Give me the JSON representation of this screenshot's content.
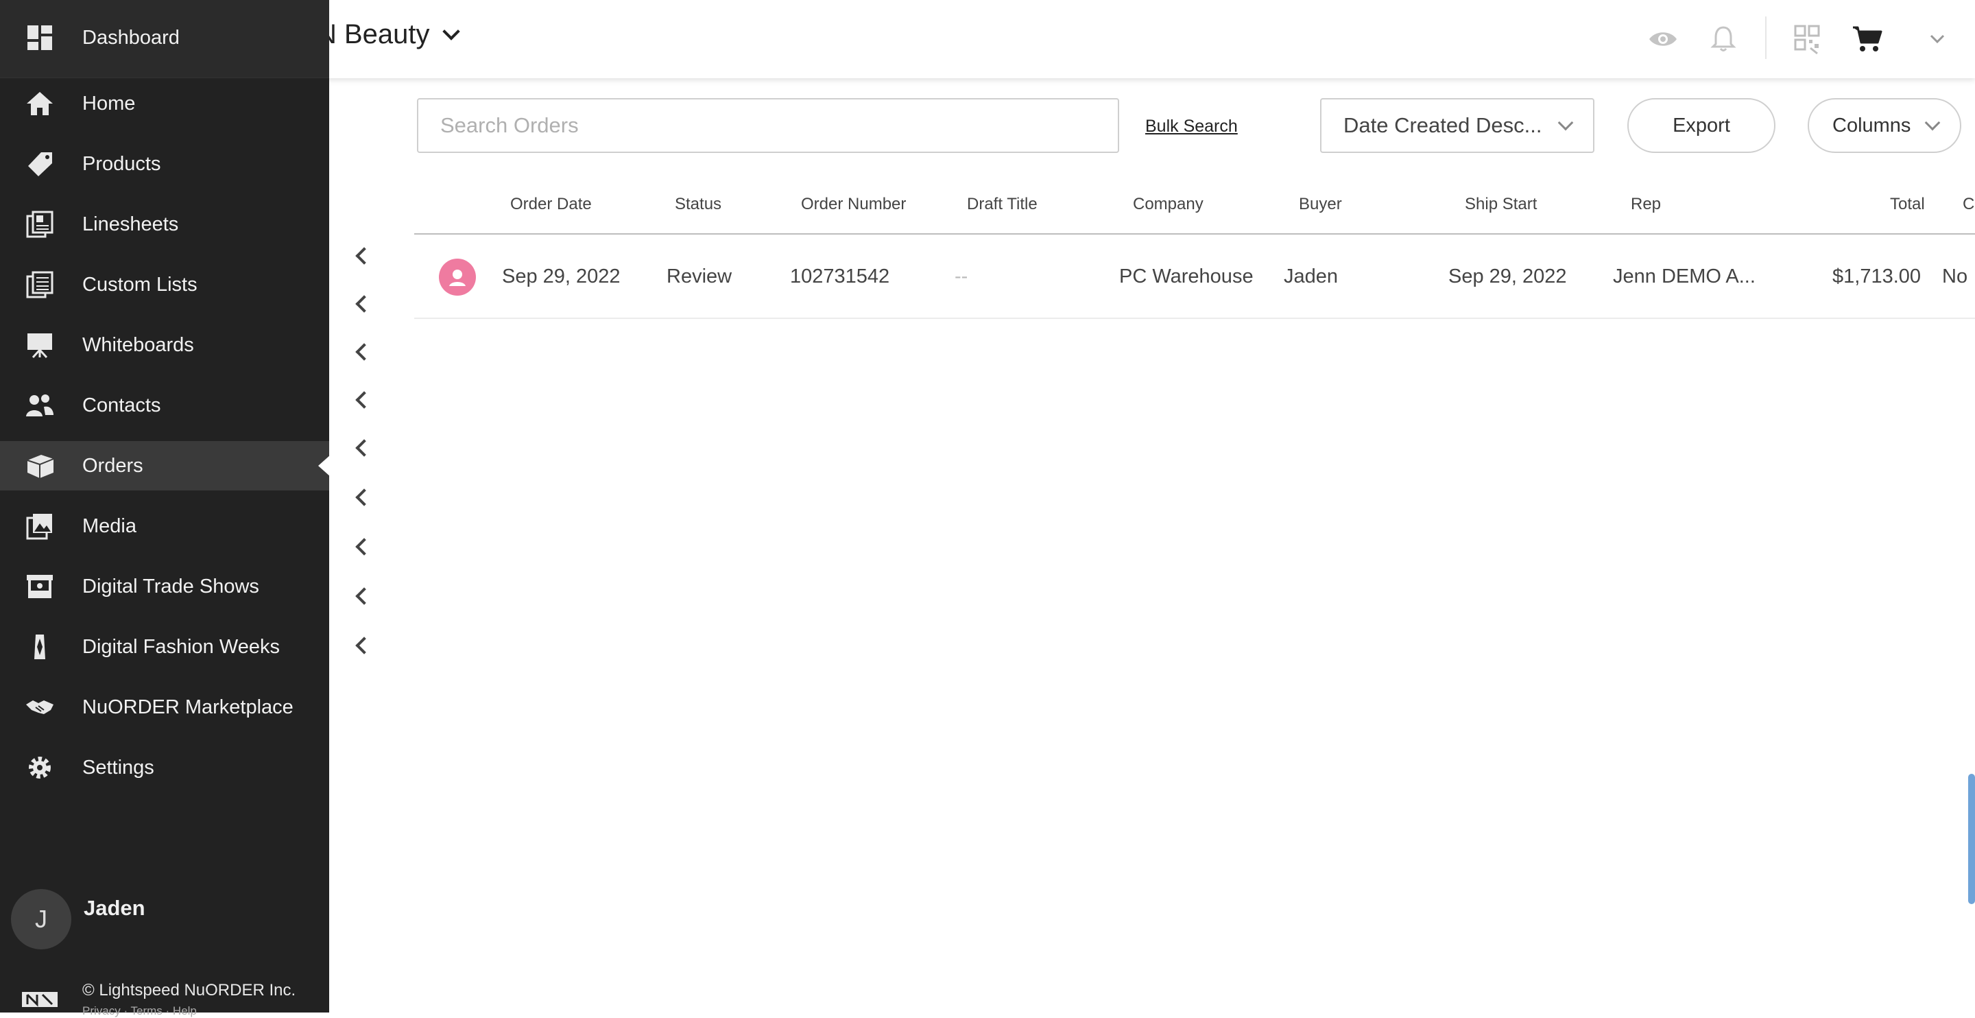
{
  "header": {
    "brand_name": "N Beauty",
    "icons": [
      "eye-icon",
      "bell-icon",
      "qr-code-icon",
      "cart-icon",
      "chevron-down-icon"
    ]
  },
  "sidebar": {
    "items": [
      {
        "label": "Dashboard",
        "icon": "dashboard-icon"
      },
      {
        "label": "Home",
        "icon": "home-icon"
      },
      {
        "label": "Products",
        "icon": "tag-icon"
      },
      {
        "label": "Linesheets",
        "icon": "linesheet-icon"
      },
      {
        "label": "Custom Lists",
        "icon": "list-icon"
      },
      {
        "label": "Whiteboards",
        "icon": "easel-icon"
      },
      {
        "label": "Contacts",
        "icon": "contacts-icon"
      },
      {
        "label": "Orders",
        "icon": "box-icon",
        "active": true
      },
      {
        "label": "Media",
        "icon": "media-icon"
      },
      {
        "label": "Digital Trade Shows",
        "icon": "booth-icon"
      },
      {
        "label": "Digital Fashion Weeks",
        "icon": "dress-icon"
      },
      {
        "label": "NuORDER Marketplace",
        "icon": "handshake-icon"
      },
      {
        "label": "Settings",
        "icon": "gear-icon"
      }
    ],
    "user": {
      "initial": "J",
      "name": "Jaden"
    },
    "copyright": "© Lightspeed NuORDER Inc.",
    "legal": "Privacy · Terms · Help"
  },
  "toolbar": {
    "search_placeholder": "Search Orders",
    "bulk_search": "Bulk Search",
    "sort_value": "Date Created Desc...",
    "export": "Export",
    "columns": "Columns"
  },
  "table": {
    "headers": [
      "Order Date",
      "Status",
      "Order Number",
      "Draft Title",
      "Company",
      "Buyer",
      "Ship Start",
      "Rep",
      "Total",
      "C"
    ],
    "rows": [
      {
        "order_date": "Sep 29, 2022",
        "status": "Review",
        "order_number": "102731542",
        "draft_title": "--",
        "company": "PC Warehouse",
        "buyer": "Jaden",
        "ship_start": "Sep 29, 2022",
        "rep": "Jenn DEMO A...",
        "total": "$1,713.00",
        "extra": "No"
      }
    ]
  },
  "colors": {
    "sidebar_bg": "#222222",
    "active_item_bg": "#3a3a3a",
    "avatar_pink": "#ef7ba0"
  }
}
